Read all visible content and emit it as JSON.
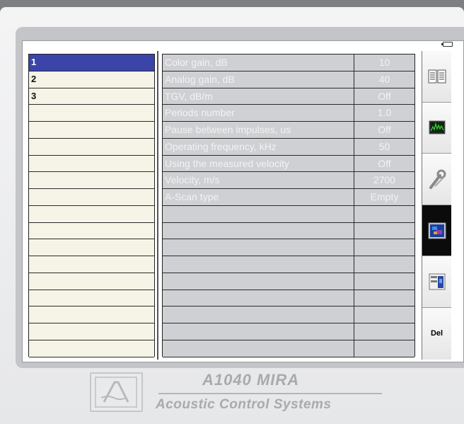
{
  "left_list": {
    "items": [
      "1",
      "2",
      "3",
      "",
      "",
      "",
      "",
      "",
      "",
      "",
      "",
      "",
      "",
      "",
      "",
      "",
      "",
      ""
    ],
    "selected_index": 0
  },
  "params": {
    "rows": [
      {
        "name": "Color gain, dB",
        "value": "10"
      },
      {
        "name": "Analog gain, dB",
        "value": "40"
      },
      {
        "name": "TGV, dB/m",
        "value": "Off"
      },
      {
        "name": "Periods number",
        "value": "1.0"
      },
      {
        "name": "Pause between impulses, us",
        "value": "Off"
      },
      {
        "name": "Operating frequency, kHz",
        "value": "50"
      },
      {
        "name": "Using the measured velocity",
        "value": "Off"
      },
      {
        "name": "Velocity, m/s",
        "value": "2700"
      },
      {
        "name": "A-Scan type",
        "value": "Empty"
      },
      {
        "name": "",
        "value": ""
      },
      {
        "name": "",
        "value": ""
      },
      {
        "name": "",
        "value": ""
      },
      {
        "name": "",
        "value": ""
      },
      {
        "name": "",
        "value": ""
      },
      {
        "name": "",
        "value": ""
      },
      {
        "name": "",
        "value": ""
      },
      {
        "name": "",
        "value": ""
      },
      {
        "name": "",
        "value": ""
      }
    ]
  },
  "toolbar": {
    "buttons": [
      {
        "icon": "document-icon"
      },
      {
        "icon": "ascan-display-icon"
      },
      {
        "icon": "wrench-icon"
      },
      {
        "icon": "bscan-image-icon",
        "active": true
      },
      {
        "icon": "screen-panel-icon"
      },
      {
        "icon": "delete-icon",
        "label": "Del"
      }
    ]
  },
  "footer": {
    "model": "A1040 MIRA",
    "company": "Acoustic Control Systems"
  },
  "colors": {
    "selection": "#3b44a8",
    "param_bg": "#cfd0d4",
    "list_bg": "#f6f4e6",
    "active_tool": "#0b0b0b"
  }
}
